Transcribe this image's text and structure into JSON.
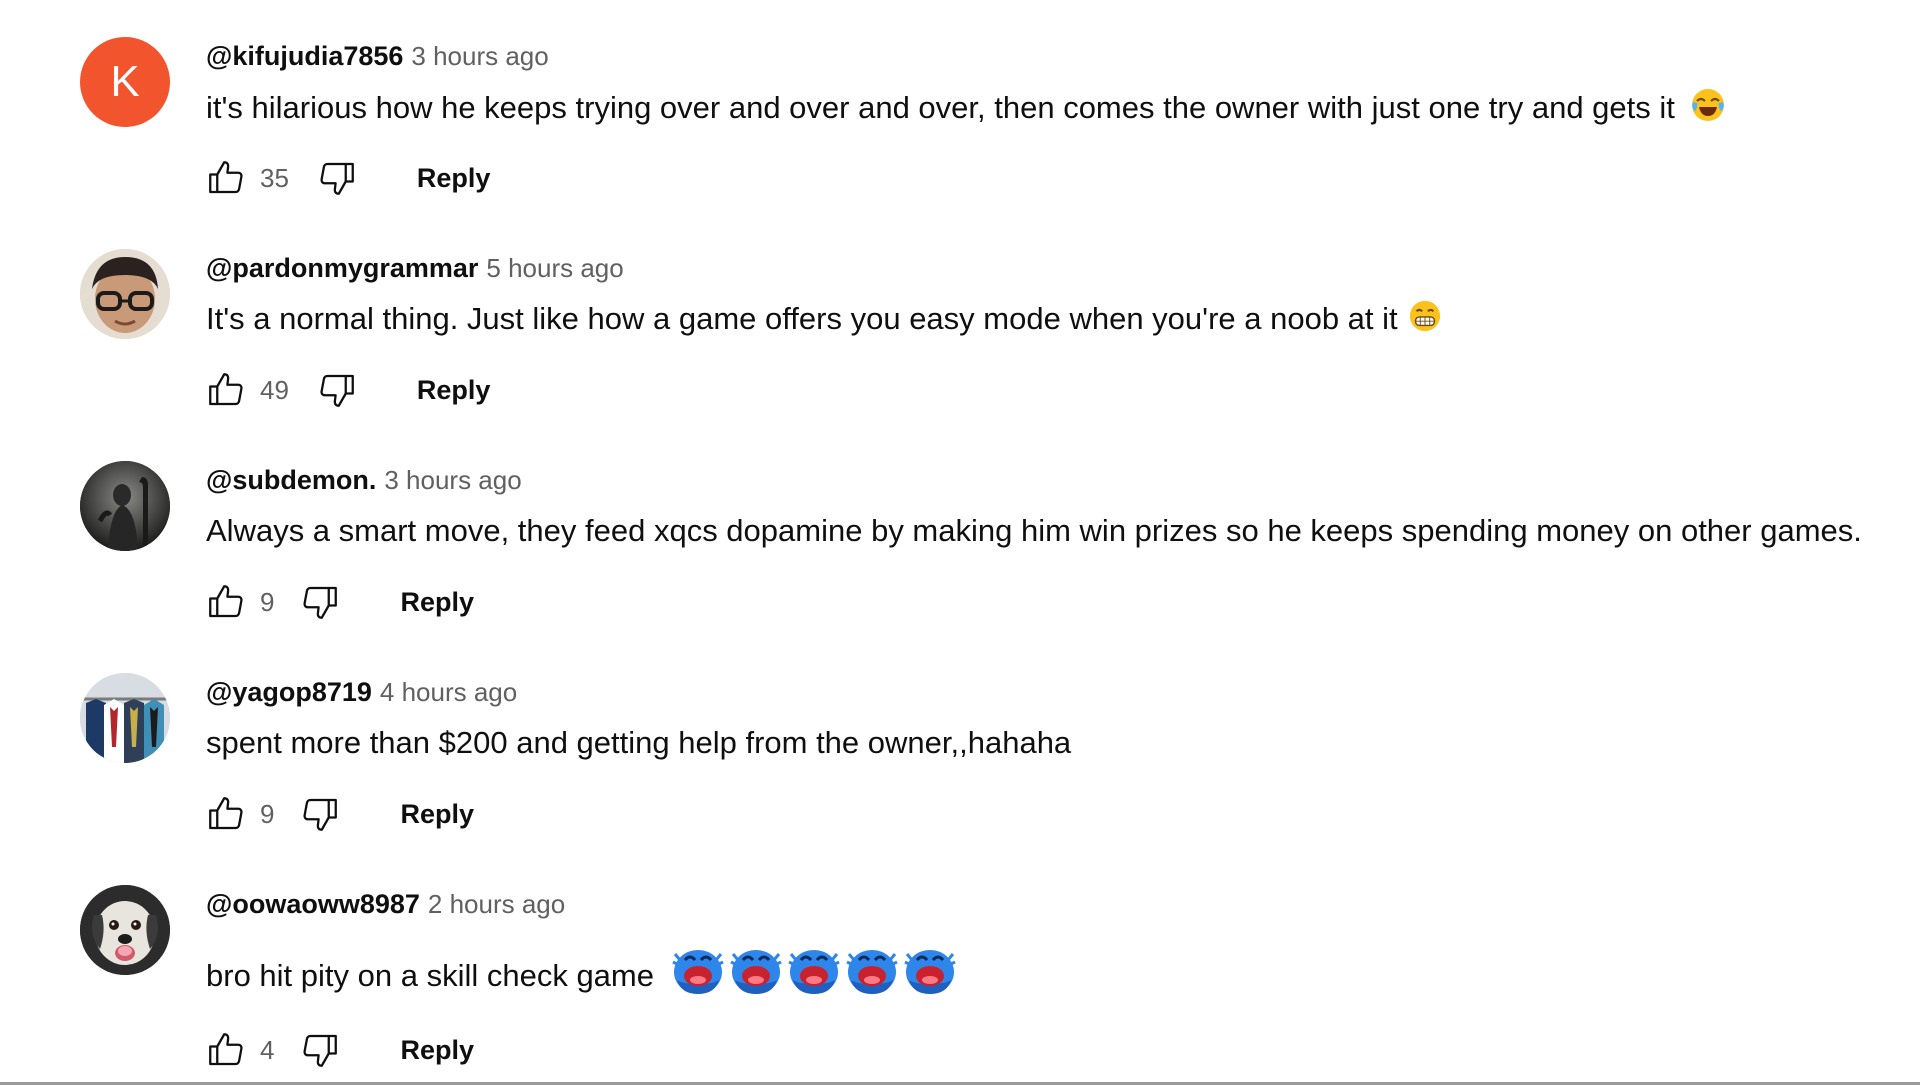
{
  "colors": {
    "avatar_k": "#f2542d",
    "author": "#0f0f0f",
    "meta": "#606060"
  },
  "comments": [
    {
      "author": "@kifujudia7856",
      "time": "3 hours ago",
      "text": "it's hilarious how he keeps trying over and over and over, then comes the owner with just one try and gets it",
      "emoji": "face-with-tears-of-joy",
      "likes": "35",
      "reply_label": "Reply",
      "avatar_letter": "K"
    },
    {
      "author": "@pardonmygrammar",
      "time": "5 hours ago",
      "text": "It's a normal thing. Just like how a game offers you easy mode when you're a noob at it",
      "emoji": "grimacing-face",
      "likes": "49",
      "reply_label": "Reply"
    },
    {
      "author": "@subdemon.",
      "time": "3 hours ago",
      "text": "Always a smart move, they feed xqcs dopamine by making him win prizes so he keeps spending money on other games.",
      "likes": "9",
      "reply_label": "Reply"
    },
    {
      "author": "@yagop8719",
      "time": "4 hours ago",
      "text": "spent more than $200 and getting help from the owner,,hahaha",
      "likes": "9",
      "reply_label": "Reply"
    },
    {
      "author": "@oowaoww8987",
      "time": "2 hours ago",
      "text": "bro hit pity on a skill check game",
      "emoji": "blue-laughing-blob-x5",
      "likes": "4",
      "reply_label": "Reply"
    }
  ]
}
